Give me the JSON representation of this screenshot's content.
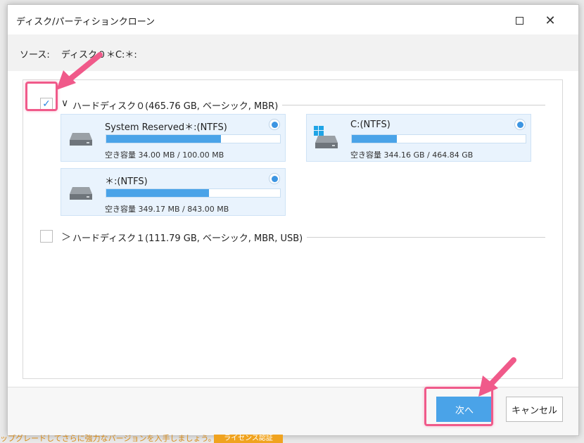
{
  "window": {
    "title": "ディスク/パーティションクローン",
    "maximize_icon": "maximize-icon",
    "close_icon": "close-icon",
    "close_glyph": "✕"
  },
  "source": {
    "label": "ソース:",
    "value": "ディスク０＊C:＊:"
  },
  "disks": [
    {
      "label": "ハードディスク０(465.76 GB, ベーシック, MBR)",
      "checked": true,
      "check_glyph": "✓",
      "expanded": true,
      "chevron_glyph": "∨",
      "partitions": [
        {
          "name": "System Reserved＊:(NTFS)",
          "used_fraction": 0.66,
          "free_text": "空き容量 34.00 MB / 100.00 MB",
          "selected": true,
          "icon": "drive-icon"
        },
        {
          "name": "C:(NTFS)",
          "used_fraction": 0.26,
          "free_text": "空き容量 344.16 GB / 464.84 GB",
          "selected": true,
          "icon": "windows-drive-icon"
        },
        {
          "name": "＊:(NTFS)",
          "used_fraction": 0.59,
          "free_text": "空き容量 349.17 MB / 843.00 MB",
          "selected": true,
          "icon": "drive-icon"
        }
      ]
    },
    {
      "label": "ハードディスク１(111.79 GB, ベーシック, MBR, USB)",
      "checked": false,
      "expanded": false,
      "chevron_glyph": "＞"
    }
  ],
  "buttons": {
    "next": "次へ",
    "cancel": "キャンセル"
  },
  "banner": {
    "text": "ップグレードしてさらに強力なバージョンを入手しましょう。",
    "badge": "ライセンス認証"
  },
  "colors": {
    "accent": "#4aa3e8",
    "highlight": "#f05a8a",
    "partition_bg": "#e9f3fd"
  }
}
